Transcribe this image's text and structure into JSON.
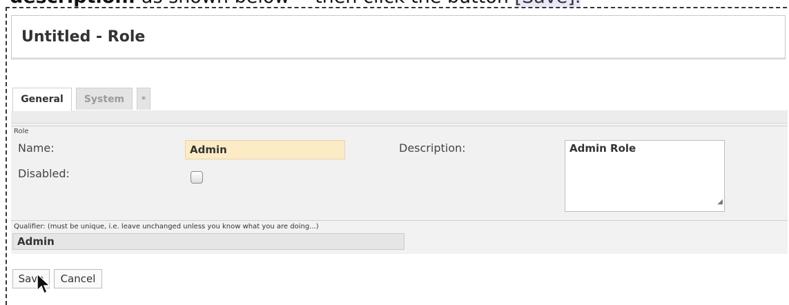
{
  "instruction": {
    "bold_part": "description:",
    "rest": " as shown below -- then click the button ",
    "button_ref": "[Save]."
  },
  "header": {
    "title": "Untitled - Role"
  },
  "tabs": [
    {
      "label": "General",
      "active": true
    },
    {
      "label": "System",
      "active": false
    },
    {
      "label": "*",
      "active": false
    }
  ],
  "role_section": {
    "legend": "Role",
    "name_label": "Name:",
    "name_value": "Admin",
    "disabled_label": "Disabled:",
    "disabled_checked": false,
    "description_label": "Description:",
    "description_value": "Admin Role"
  },
  "qualifier": {
    "label": "Qualifier: (must be unique, i.e. leave unchanged unless you know what you are doing...)",
    "value": "Admin"
  },
  "actions": {
    "save_label": "Save",
    "cancel_label": "Cancel"
  },
  "colors": {
    "name_field_bg": "#fdebc6",
    "panel_bg": "#f2f2f2"
  }
}
